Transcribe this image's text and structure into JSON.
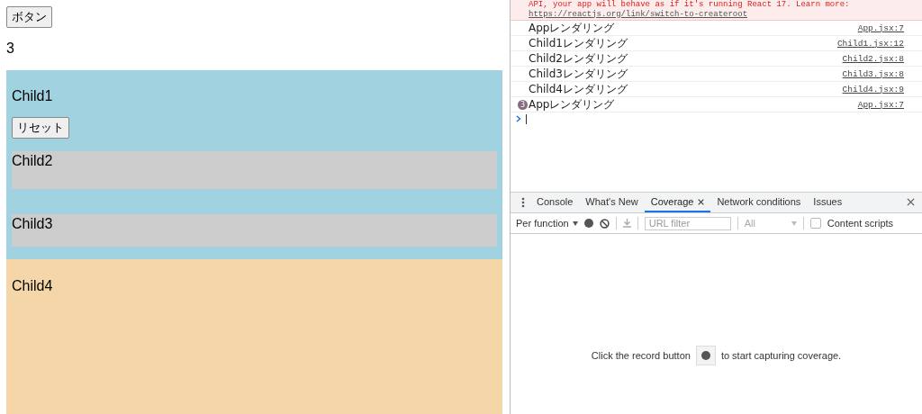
{
  "app": {
    "button": "ボタン",
    "count": "3",
    "child1": {
      "title": "Child1",
      "reset_button": "リセット"
    },
    "child2": {
      "title": "Child2"
    },
    "child3": {
      "title": "Child3"
    },
    "child4": {
      "title": "Child4"
    }
  },
  "console": {
    "messages": [
      {
        "kind": "error",
        "text": "API, your app will behave as if it's running React 17. Learn more: ",
        "link": "https://reactjs.org/link/switch-to-createroot"
      },
      {
        "kind": "log",
        "text": "Appレンダリング",
        "source": "App.jsx:7"
      },
      {
        "kind": "log",
        "text": "Child1レンダリング",
        "source": "Child1.jsx:12"
      },
      {
        "kind": "log",
        "text": "Child2レンダリング",
        "source": "Child2.jsx:8"
      },
      {
        "kind": "log",
        "text": "Child3レンダリング",
        "source": "Child3.jsx:8"
      },
      {
        "kind": "log",
        "text": "Child4レンダリング",
        "source": "Child4.jsx:9"
      },
      {
        "kind": "log",
        "text": "Appレンダリング",
        "source": "App.jsx:7",
        "count": "3"
      }
    ]
  },
  "drawer": {
    "tabs": [
      {
        "label": "Console",
        "selected": false,
        "closable": false
      },
      {
        "label": "What's New",
        "selected": false,
        "closable": false
      },
      {
        "label": "Coverage",
        "selected": true,
        "closable": true
      },
      {
        "label": "Network conditions",
        "selected": false,
        "closable": false
      },
      {
        "label": "Issues",
        "selected": false,
        "closable": false
      }
    ],
    "toolbar": {
      "mode": "Per function",
      "url_filter": {
        "placeholder": "URL filter"
      },
      "type_filter": {
        "value": "All",
        "disabled": true
      },
      "download_disabled": true,
      "content_scripts": {
        "label": "Content scripts",
        "checked": false
      }
    },
    "empty_message": {
      "before": "Click the record button",
      "after": "to start capturing coverage."
    }
  }
}
